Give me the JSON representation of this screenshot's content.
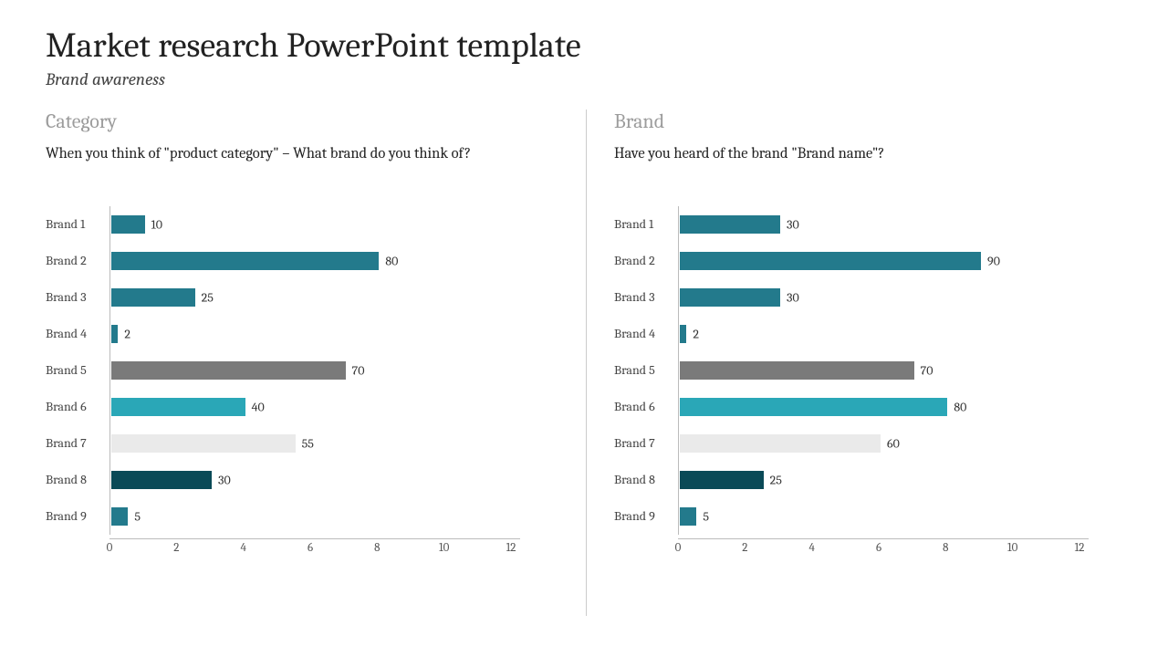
{
  "title": "Market research PowerPoint template",
  "subtitle": "Brand awareness",
  "left": {
    "title": "Category",
    "question": "When you think of \"product category\" – What brand do you think of?"
  },
  "right": {
    "title": "Brand",
    "question": "Have you heard of the brand \"Brand name\"?"
  },
  "chart_data": [
    {
      "type": "bar",
      "orientation": "horizontal",
      "title": "Category",
      "question": "When you think of \"product category\" – What brand do you think of?",
      "categories": [
        "Brand 1",
        "Brand 2",
        "Brand 3",
        "Brand 4",
        "Brand 5",
        "Brand 6",
        "Brand 7",
        "Brand 8",
        "Brand 9"
      ],
      "values": [
        10,
        80,
        25,
        2,
        70,
        40,
        55,
        30,
        5
      ],
      "bar_colors": [
        "#237a8c",
        "#237a8c",
        "#237a8c",
        "#237a8c",
        "#7a7a7a",
        "#2aa7b7",
        "#eaeaea",
        "#0a4a57",
        "#237a8c"
      ],
      "xlabel": "",
      "ylabel": "",
      "x_ticks": [
        0,
        2,
        4,
        6,
        8,
        10,
        12
      ],
      "xlim": [
        0,
        12
      ],
      "value_scale_note": "Bar lengths are plotted as value/10 on the 0–12 axis; labels show raw values."
    },
    {
      "type": "bar",
      "orientation": "horizontal",
      "title": "Brand",
      "question": "Have you heard of the brand \"Brand name\"?",
      "categories": [
        "Brand 1",
        "Brand 2",
        "Brand 3",
        "Brand 4",
        "Brand 5",
        "Brand 6",
        "Brand 7",
        "Brand 8",
        "Brand 9"
      ],
      "values": [
        30,
        90,
        30,
        2,
        70,
        80,
        60,
        25,
        5
      ],
      "bar_colors": [
        "#237a8c",
        "#237a8c",
        "#237a8c",
        "#237a8c",
        "#7a7a7a",
        "#2aa7b7",
        "#eaeaea",
        "#0a4a57",
        "#237a8c"
      ],
      "xlabel": "",
      "ylabel": "",
      "x_ticks": [
        0,
        2,
        4,
        6,
        8,
        10,
        12
      ],
      "xlim": [
        0,
        12
      ],
      "value_scale_note": "Bar lengths are plotted as value/10 on the 0–12 axis; labels show raw values."
    }
  ]
}
